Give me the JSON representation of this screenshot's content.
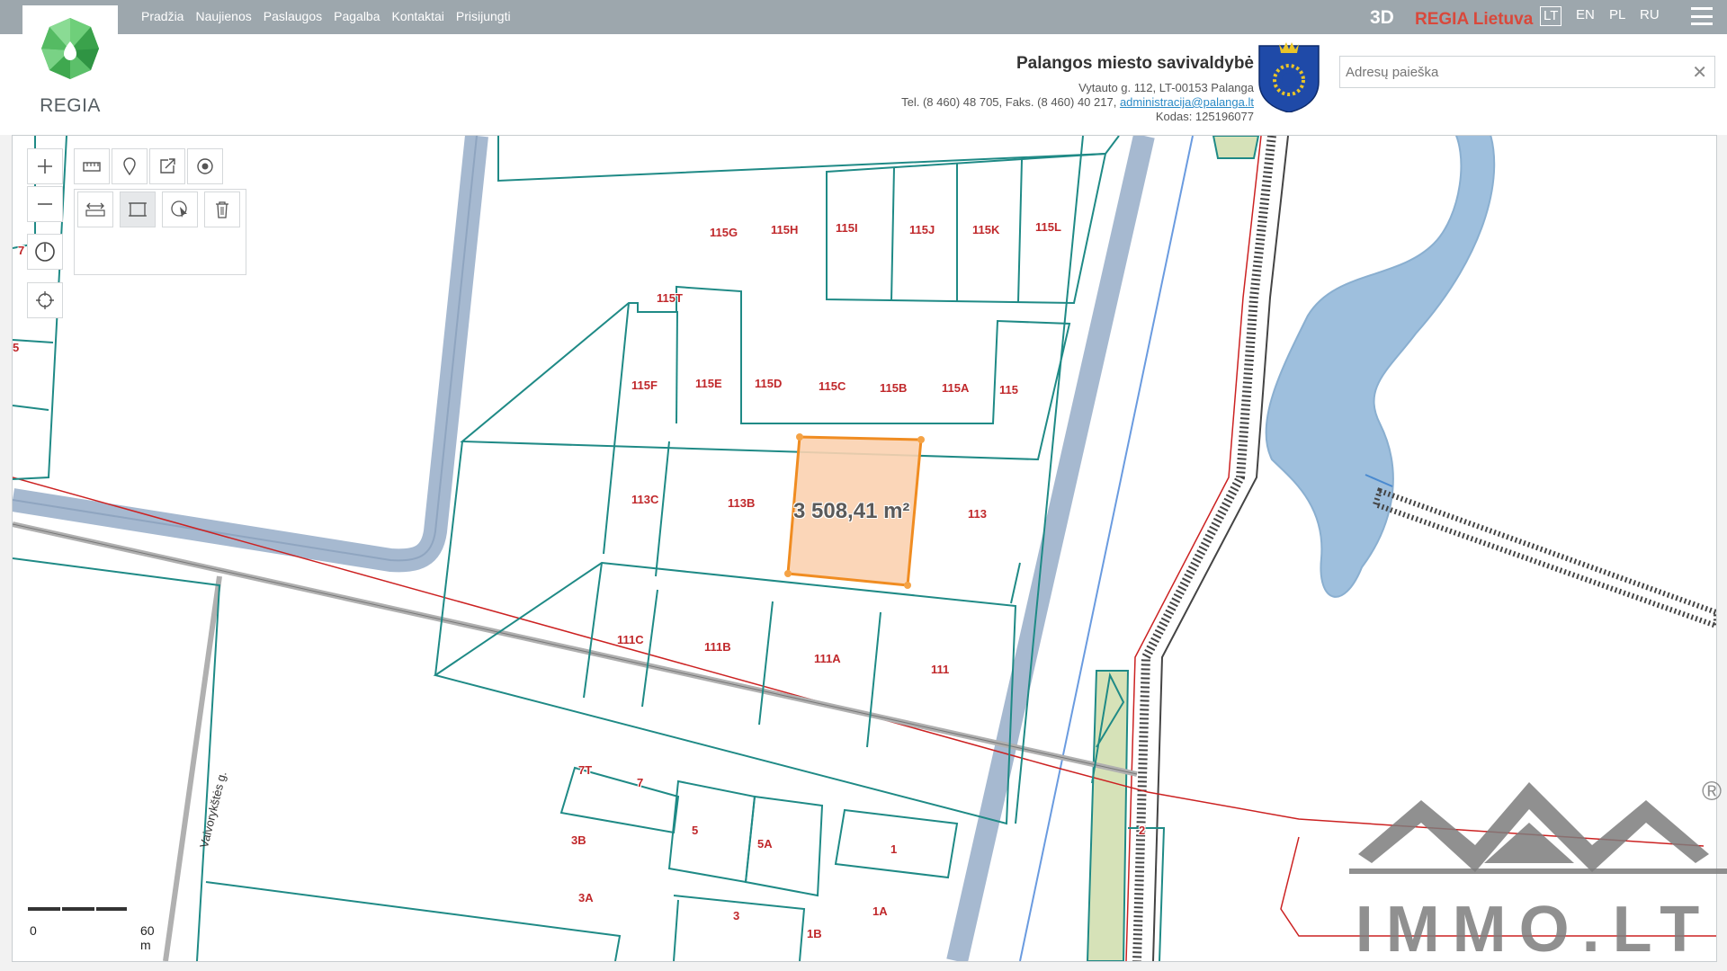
{
  "brand": {
    "logo_text": "REGIA"
  },
  "nav": [
    "Pradžia",
    "Naujienos",
    "Paslaugos",
    "Pagalba",
    "Kontaktai",
    "Prisijungti"
  ],
  "topbar": {
    "mode_3d": "3D",
    "site_name": "REGIA Lietuva",
    "languages": [
      {
        "code": "LT",
        "active": true
      },
      {
        "code": "EN",
        "active": false
      },
      {
        "code": "PL",
        "active": false
      },
      {
        "code": "RU",
        "active": false
      }
    ],
    "menu_icon": "hamburger-menu-icon"
  },
  "municipality": {
    "name": "Palangos miesto savivaldybė",
    "address": "Vytauto g. 112, LT-00153 Palanga",
    "contacts_prefix": "Tel. (8 460) 48 705, Faks. (8 460) 40 217, ",
    "email": "administracija@palanga.lt",
    "code": "Kodas: 125196077",
    "crest_icon": "palanga-coat-of-arms"
  },
  "search": {
    "placeholder": "Adresų paieška",
    "value": "",
    "clear_icon": "close-icon"
  },
  "map": {
    "measurement": "3 508,41 m²",
    "scale": {
      "start": "0",
      "end": "60 m"
    },
    "street": "Vaivorykštės g.",
    "plots": [
      "115G",
      "115H",
      "115I",
      "115J",
      "115K",
      "115L",
      "115T",
      "115F",
      "115E",
      "115D",
      "115C",
      "115B",
      "115A",
      "115",
      "113C",
      "113B",
      "113",
      "111C",
      "111B",
      "111A",
      "111",
      "7T",
      "7",
      "5",
      "5A",
      "1",
      "3B",
      "3A",
      "3",
      "1B",
      "1A",
      "2"
    ],
    "edge_labels": [
      "7",
      "5"
    ],
    "colors": {
      "parcel": "#1f8a86",
      "plot_label": "#c0282b",
      "road": "#9db9d6",
      "water": "#9ebfdd",
      "selection_fill": "#fbd2b0",
      "selection_stroke": "#f08c21",
      "power_line": "#cc2222",
      "green": "#d6e2b8"
    }
  },
  "map_controls": {
    "zoom_in_icon": "plus-icon",
    "zoom_out_icon": "minus-icon",
    "compass_icon": "compass-icon",
    "locate_icon": "crosshair-icon",
    "tools_row1": [
      "ruler-icon",
      "map-pin-icon",
      "share-icon",
      "record-icon"
    ],
    "tools_row2": [
      "measure-distance-icon",
      "measure-area-icon",
      "identify-icon",
      "trash-icon"
    ]
  },
  "watermark": {
    "text": "IMMO.LT",
    "registered": "®"
  }
}
